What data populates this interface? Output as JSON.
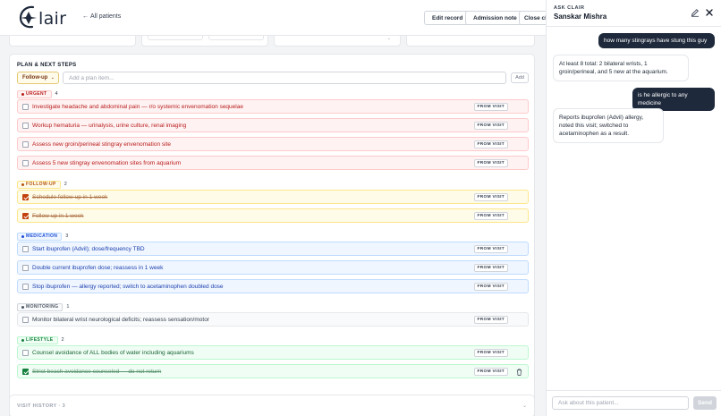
{
  "header": {
    "logo_text": "lair",
    "back_label": "All patients",
    "edit_record_label": "Edit record",
    "admission_note_label": "Admission note",
    "close_chart_label": "Close ch"
  },
  "plan": {
    "title": "PLAN & NEXT STEPS",
    "category_value": "Follow-up",
    "input_placeholder": "Add a plan item...",
    "add_label": "Add",
    "from_visit_label": "FROM VISIT",
    "groups": [
      {
        "key": "urgent",
        "label": "URGENT",
        "count": "4",
        "color": "#b91c1c",
        "items": [
          {
            "text": "Investigate headache and abdominal pain — r/o systemic envenomation sequelae",
            "checked": false
          },
          {
            "text": "Workup hematuria — urinalysis, urine culture, renal imaging",
            "checked": false
          },
          {
            "text": "Assess new groin/perineal stingray envenomation site",
            "checked": false
          },
          {
            "text": "Assess 5 new stingray envenomation sites from aquarium",
            "checked": false
          }
        ]
      },
      {
        "key": "followup",
        "label": "FOLLOW-UP",
        "count": "2",
        "color": "#b45309",
        "items": [
          {
            "text": "Schedule follow-up in 1 week",
            "checked": true
          },
          {
            "text": "Follow-up in 1 week",
            "checked": true
          }
        ]
      },
      {
        "key": "medication",
        "label": "MEDICATION",
        "count": "3",
        "color": "#1d4ed8",
        "items": [
          {
            "text": "Start ibuprofen (Advil); dose/frequency TBD",
            "checked": false
          },
          {
            "text": "Double current ibuprofen dose; reassess in 1 week",
            "checked": false
          },
          {
            "text": "Stop ibuprofen — allergy reported; switch to acetaminophen doubled dose",
            "checked": false
          }
        ]
      },
      {
        "key": "monitoring",
        "label": "MONITORING",
        "count": "1",
        "color": "#4b5563",
        "items": [
          {
            "text": "Monitor bilateral wrist neurological deficits; reassess sensation/motor",
            "checked": false
          }
        ]
      },
      {
        "key": "lifestyle",
        "label": "LIFESTYLE",
        "count": "2",
        "color": "#15803d",
        "items": [
          {
            "text": "Counsel avoidance of ALL bodies of water including aquariums",
            "checked": false
          },
          {
            "text": "Strict beach avoidance counseled — do not return",
            "checked": true
          }
        ]
      }
    ]
  },
  "visit_history": {
    "label": "VISIT HISTORY · 3"
  },
  "chat": {
    "subtitle": "ASK CLAIR",
    "patient_name": "Sanskar Mishra",
    "messages": [
      {
        "role": "user",
        "text": "how many stingrays have stung this guy"
      },
      {
        "role": "bot",
        "text": "At least 8 total: 2 bilateral wrists, 1 groin/perineal, and 5 new at the aquarium."
      },
      {
        "role": "user",
        "text": "is he allergic to any medicine"
      },
      {
        "role": "bot",
        "text": "Reports ibuprofen (Advil) allergy, noted this visit; switched to acetaminophen as a result."
      }
    ],
    "input_placeholder": "Ask about this patient...",
    "send_label": "Send"
  }
}
